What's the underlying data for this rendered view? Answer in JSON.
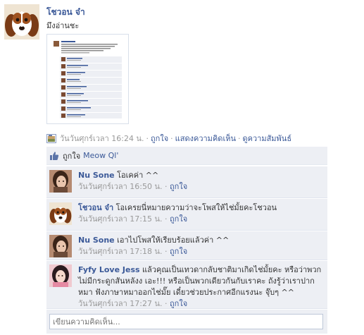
{
  "post": {
    "author": "โชวอน จ๋า",
    "text": "มึงอ่านชะ",
    "timestamp": "วันวันศุกร์เวลา 16:24 น.",
    "actions": [
      "ถูกใจ",
      "แสดงความคิดเห็น",
      "ดูความสัมพันธ์"
    ]
  },
  "likes": {
    "prefix": "ถูกใจ",
    "name": "Meow Ql'"
  },
  "comments": [
    {
      "name": "Nu Sone",
      "text": "โอเคค่า ^^",
      "timestamp": "วันวันศุกร์เวลา 16:50 น.",
      "like": "ถูกใจ"
    },
    {
      "name": "โชวอน จ๋า",
      "text": "โอเครยนี่หมายความว่าจะโพสให้ไช่มั้ยคะโชวอน",
      "timestamp": "วันวันศุกร์เวลา 17:15 น.",
      "like": "ถูกใจ"
    },
    {
      "name": "Nu Sone",
      "text": "เอาไปโพสให้เรียบร้อยแล้วค่า ^^",
      "timestamp": "วันวันศุกร์เวลา 17:18 น.",
      "like": "ถูกใจ"
    },
    {
      "name": "Fyfy Love Jess",
      "text": "แล้วคุณเป็นเทวดากลับชาติมาเกิดไช่มั้ยคะ หรือว่าพวกไม่มีกระดูกสันหลังง เอะ!!! หรือเป็นพวกเดียวกันกับเราคะ ถังรู้ว่าเราปากหมา ฟังภาษาหมาออกไช่มั๊ย เดี๋ยวช่วยประกาศอีกแรงนะ จุ๊บๆ ^^",
      "timestamp": "วันวันศุกร์เวลา 17:27 น.",
      "like": "ถูกใจ"
    }
  ],
  "reply": {
    "placeholder": "เขียนความคิดเห็น..."
  },
  "colors": {
    "link": "#3b5998",
    "feedback_bg": "#edeff4",
    "muted": "#999999"
  }
}
